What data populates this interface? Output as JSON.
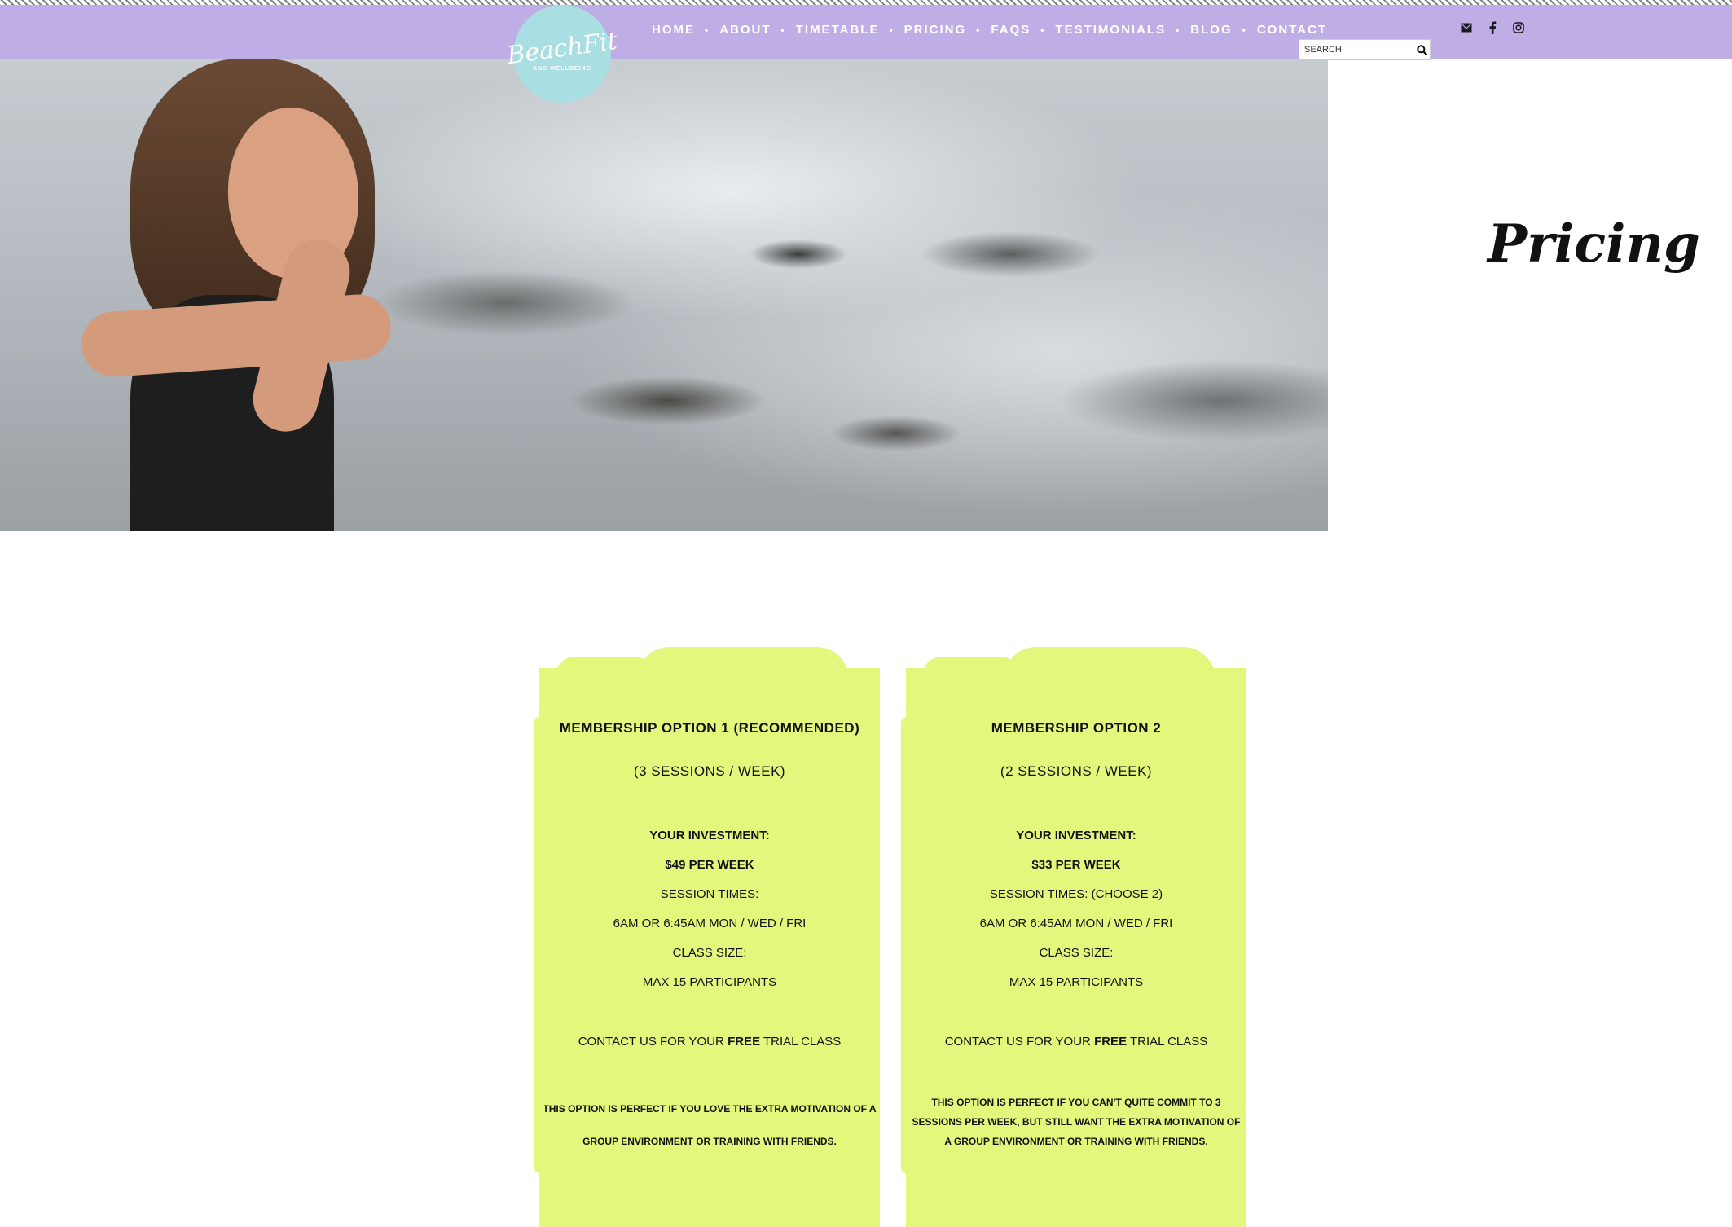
{
  "brand": {
    "logo_text": "BeachFit",
    "logo_sub": "AND WELLBEING",
    "band_color": "#bfaee6",
    "logo_color": "#a9dfe2"
  },
  "nav": {
    "items": [
      {
        "label": "HOME"
      },
      {
        "label": "ABOUT"
      },
      {
        "label": "TIMETABLE"
      },
      {
        "label": "PRICING"
      },
      {
        "label": "FAQS"
      },
      {
        "label": "TESTIMONIALS"
      },
      {
        "label": "BLOG"
      },
      {
        "label": "CONTACT"
      }
    ],
    "separator": "•"
  },
  "social": {
    "icons": [
      "envelope-icon",
      "facebook-icon",
      "instagram-icon"
    ]
  },
  "search": {
    "placeholder": "SEARCH",
    "icon": "search-icon"
  },
  "hero": {
    "page_title": "Pricing"
  },
  "cards": [
    {
      "title": "MEMBERSHIP OPTION 1 (RECOMMENDED)",
      "sessions": "(3 SESSIONS / WEEK)",
      "investment_label": "YOUR INVESTMENT:",
      "price": "$49 PER WEEK",
      "times_label": "SESSION TIMES:",
      "times": "6AM OR 6:45AM MON / WED / FRI",
      "class_size_label": "CLASS SIZE:",
      "class_size": "MAX 15 PARTICIPANTS",
      "trial_prefix": "CONTACT US FOR YOUR ",
      "trial_bold": "FREE",
      "trial_suffix": " TRIAL CLASS",
      "note": "THIS OPTION IS PERFECT IF YOU LOVE THE EXTRA MOTIVATION OF A GROUP ENVIRONMENT OR TRAINING WITH FRIENDS."
    },
    {
      "title": "MEMBERSHIP OPTION 2",
      "sessions": "(2 SESSIONS / WEEK)",
      "investment_label": "YOUR INVESTMENT:",
      "price": "$33 PER WEEK",
      "times_label": "SESSION TIMES: (CHOOSE 2)",
      "times": "6AM OR 6:45AM MON / WED / FRI",
      "class_size_label": "CLASS SIZE:",
      "class_size": "MAX 15 PARTICIPANTS",
      "trial_prefix": "CONTACT US FOR YOUR ",
      "trial_bold": "FREE",
      "trial_suffix": " TRIAL CLASS",
      "note": "THIS OPTION IS PERFECT IF YOU CAN'T QUITE COMMIT TO 3 SESSIONS PER WEEK, BUT STILL WANT THE  EXTRA MOTIVATION OF A GROUP ENVIRONMENT OR TRAINING WITH FRIENDS."
    }
  ],
  "card_color": "#e4f77d"
}
